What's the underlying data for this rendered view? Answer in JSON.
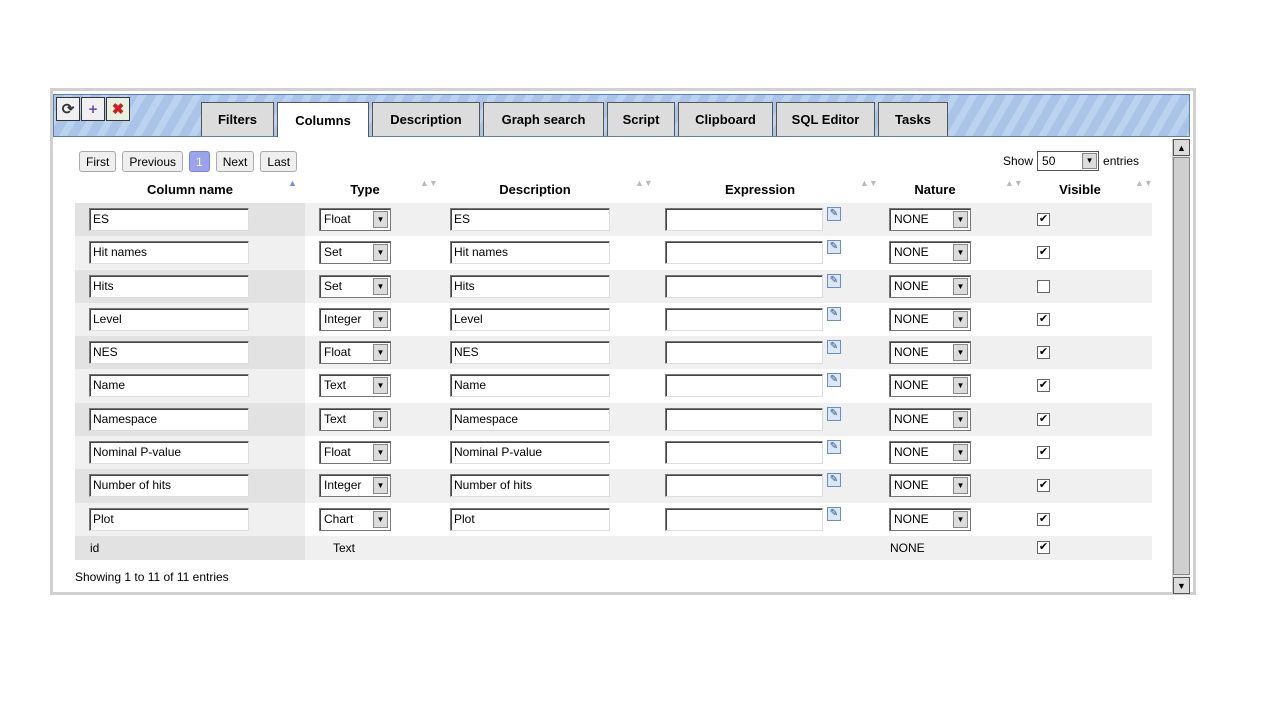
{
  "toolbar": {
    "icons": [
      "refresh-icon",
      "add-icon",
      "remove-icon"
    ],
    "icon_glyphs": [
      "⟳",
      "+",
      "✖"
    ]
  },
  "tabs": [
    {
      "label": "Filters"
    },
    {
      "label": "Columns",
      "active": true
    },
    {
      "label": "Description"
    },
    {
      "label": "Graph search"
    },
    {
      "label": "Script"
    },
    {
      "label": "Clipboard"
    },
    {
      "label": "SQL Editor"
    },
    {
      "label": "Tasks"
    }
  ],
  "pager": {
    "first": "First",
    "previous": "Previous",
    "current": "1",
    "next": "Next",
    "last": "Last"
  },
  "show": {
    "prefix": "Show",
    "value": "50",
    "suffix": "entries"
  },
  "headers": {
    "column_name": "Column name",
    "type": "Type",
    "description": "Description",
    "expression": "Expression",
    "nature": "Nature",
    "visible": "Visible"
  },
  "sort": {
    "asc_glyph": "▲",
    "both_glyph": "▲▼"
  },
  "rows": [
    {
      "name": "ES",
      "type": "Float",
      "description": "ES",
      "expression": "",
      "nature": "NONE",
      "visible": true
    },
    {
      "name": "Hit names",
      "type": "Set",
      "description": "Hit names",
      "expression": "",
      "nature": "NONE",
      "visible": true
    },
    {
      "name": "Hits",
      "type": "Set",
      "description": "Hits",
      "expression": "",
      "nature": "NONE",
      "visible": false
    },
    {
      "name": "Level",
      "type": "Integer",
      "description": "Level",
      "expression": "",
      "nature": "NONE",
      "visible": true
    },
    {
      "name": "NES",
      "type": "Float",
      "description": "NES",
      "expression": "",
      "nature": "NONE",
      "visible": true
    },
    {
      "name": "Name",
      "type": "Text",
      "description": "Name",
      "expression": "",
      "nature": "NONE",
      "visible": true
    },
    {
      "name": "Namespace",
      "type": "Text",
      "description": "Namespace",
      "expression": "",
      "nature": "NONE",
      "visible": true
    },
    {
      "name": "Nominal P-value",
      "type": "Float",
      "description": "Nominal P-value",
      "expression": "",
      "nature": "NONE",
      "visible": true
    },
    {
      "name": "Number of hits",
      "type": "Integer",
      "description": "Number of hits",
      "expression": "",
      "nature": "NONE",
      "visible": true
    },
    {
      "name": "Plot",
      "type": "Chart",
      "description": "Plot",
      "expression": "",
      "nature": "NONE",
      "visible": true
    }
  ],
  "static_row": {
    "name": "id",
    "type": "Text",
    "nature": "NONE",
    "visible": true
  },
  "footer": "Showing 1 to 11 of 11 entries",
  "glyphs": {
    "dropdown": "▼",
    "check": "✔",
    "edit": "✎",
    "scroll_up": "▲",
    "scroll_down": "▼"
  }
}
